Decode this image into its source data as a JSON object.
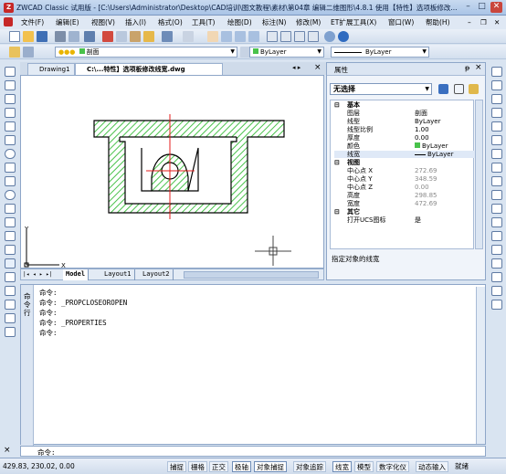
{
  "window": {
    "title": "ZWCAD Classic 试用版 - [C:\\Users\\Administrator\\Desktop\\CAD培训\\图文教程\\素材\\第04章 编辑二维图形\\4.8.1 使用【特性】选项板修改...",
    "min": "–",
    "max": "□",
    "close": "✕"
  },
  "menu": [
    "文件(F)",
    "编辑(E)",
    "视图(V)",
    "插入(I)",
    "格式(O)",
    "工具(T)",
    "绘图(D)",
    "标注(N)",
    "修改(M)",
    "ET扩展工具(X)",
    "窗口(W)",
    "帮助(H)"
  ],
  "mdi": {
    "min": "–",
    "restore": "❐",
    "close": "✕"
  },
  "toolbar2": {
    "layer_combo": "剖面",
    "color_combo": "ByLayer",
    "linetype_combo": "ByLayer"
  },
  "doctabs": [
    "Drawing1",
    "C:\\...特性】选项板修改线宽.dwg"
  ],
  "tab_close": "×",
  "layout_tabs": [
    "Model",
    "Layout1",
    "Layout2"
  ],
  "ucs": {
    "x": "X",
    "y": "Y"
  },
  "properties": {
    "title": "属性",
    "pin": "ᵽ",
    "close": "×",
    "selection": "无选择",
    "rows": [
      {
        "k": "基本",
        "v": "",
        "sec": true
      },
      {
        "k": "图层",
        "v": "剖面"
      },
      {
        "k": "线型",
        "v": "ByLayer"
      },
      {
        "k": "线型比例",
        "v": "1.00"
      },
      {
        "k": "厚度",
        "v": "0.00"
      },
      {
        "k": "颜色",
        "v": "ByLayer"
      },
      {
        "k": "线宽",
        "v": "ByLayer"
      },
      {
        "k": "视图",
        "v": "",
        "sec": true
      },
      {
        "k": "中心点 X",
        "v": "272.69",
        "grey": true
      },
      {
        "k": "中心点 Y",
        "v": "348.59",
        "grey": true
      },
      {
        "k": "中心点 Z",
        "v": "0.00",
        "grey": true
      },
      {
        "k": "高度",
        "v": "298.85",
        "grey": true
      },
      {
        "k": "宽度",
        "v": "472.69",
        "grey": true
      },
      {
        "k": "其它",
        "v": "",
        "sec": true
      },
      {
        "k": "打开UCS图标",
        "v": "是"
      }
    ],
    "description": "指定对象的线宽"
  },
  "command": {
    "label": "命令行",
    "lines": [
      "命令:",
      "命令: _PROPCLOSEOROPEN",
      "命令:",
      "命令: _PROPERTIES",
      "命令:"
    ],
    "prompt": "命令:",
    "close": "×"
  },
  "status": {
    "coords": "429.83,  230.02,  0.00",
    "buttons": [
      "捕捉",
      "栅格",
      "正交",
      "极轴",
      "对象捕捉",
      "对象追踪",
      "线宽",
      "模型",
      "数字化仪",
      "动态输入",
      "就绪"
    ]
  },
  "colors": {
    "hatch": "#49c24b",
    "center": "#e41b1b",
    "accent": "#2f5e9e"
  }
}
